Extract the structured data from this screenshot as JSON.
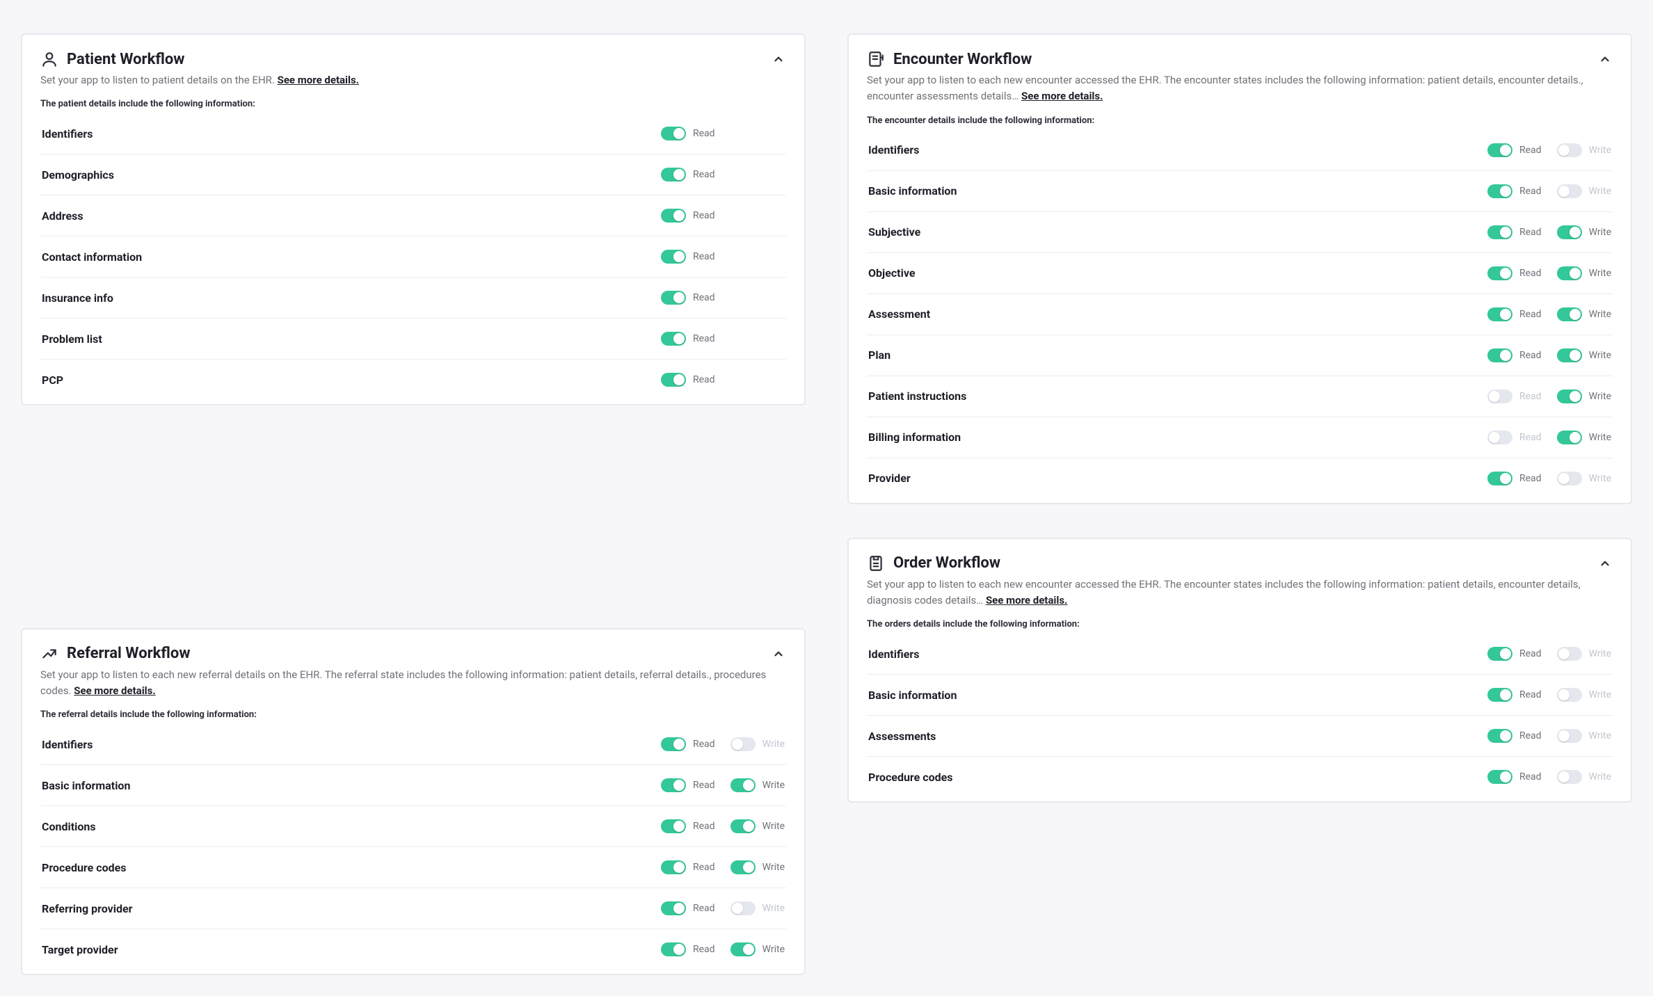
{
  "labels": {
    "read": "Read",
    "write": "Write",
    "see_more": "See more details."
  },
  "cards": {
    "patient": {
      "title": "Patient Workflow",
      "desc_pre": "Set your app to listen to patient details on the EHR. ",
      "desc_post": "",
      "subheader": "The patient details include the following information:",
      "items": [
        {
          "name": "Identifiers",
          "read": true,
          "write": null
        },
        {
          "name": "Demographics",
          "read": true,
          "write": null
        },
        {
          "name": "Address",
          "read": true,
          "write": null
        },
        {
          "name": "Contact information",
          "read": true,
          "write": null
        },
        {
          "name": "Insurance info",
          "read": true,
          "write": null
        },
        {
          "name": "Problem list",
          "read": true,
          "write": null
        },
        {
          "name": "PCP",
          "read": true,
          "write": null
        }
      ]
    },
    "encounter": {
      "title": "Encounter Workflow",
      "desc_pre": "Set your app to listen to each new encounter accessed the EHR. The encounter states includes the following information: patient details, encounter details., encounter assessments details…   ",
      "desc_post": "",
      "subheader": "The encounter details include the following information:",
      "items": [
        {
          "name": "Identifiers",
          "read": true,
          "write": false
        },
        {
          "name": "Basic information",
          "read": true,
          "write": false
        },
        {
          "name": "Subjective",
          "read": true,
          "write": true
        },
        {
          "name": "Objective",
          "read": true,
          "write": true
        },
        {
          "name": "Assessment",
          "read": true,
          "write": true
        },
        {
          "name": "Plan",
          "read": true,
          "write": true
        },
        {
          "name": "Patient instructions",
          "read": false,
          "write": true
        },
        {
          "name": "Billing information",
          "read": false,
          "write": true
        },
        {
          "name": "Provider",
          "read": true,
          "write": false
        }
      ]
    },
    "referral": {
      "title": "Referral Workflow",
      "desc_pre": "Set your app to listen to each new referral details on the EHR. The referral state includes the following information: patient details, referral details., procedures codes. ",
      "desc_post": "",
      "subheader": "The referral details include the following information:",
      "items": [
        {
          "name": "Identifiers",
          "read": true,
          "write": false
        },
        {
          "name": "Basic information",
          "read": true,
          "write": true
        },
        {
          "name": "Conditions",
          "read": true,
          "write": true
        },
        {
          "name": "Procedure codes",
          "read": true,
          "write": true
        },
        {
          "name": "Referring provider",
          "read": true,
          "write": false
        },
        {
          "name": "Target provider",
          "read": true,
          "write": true
        }
      ]
    },
    "order": {
      "title": "Order Workflow",
      "desc_pre": "Set your app to listen to each new encounter accessed the EHR. The encounter states includes the following information: patient details, encounter details, diagnosis codes details… ",
      "desc_post": "",
      "subheader": "The orders details include the following information:",
      "items": [
        {
          "name": "Identifiers",
          "read": true,
          "write": false
        },
        {
          "name": "Basic information",
          "read": true,
          "write": false
        },
        {
          "name": "Assessments",
          "read": true,
          "write": false
        },
        {
          "name": "Procedure codes",
          "read": true,
          "write": false
        }
      ]
    }
  }
}
